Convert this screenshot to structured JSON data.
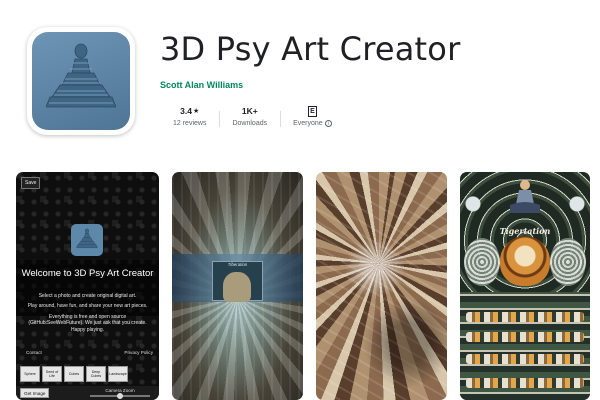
{
  "app": {
    "title": "3D Psy Art Creator",
    "developer": "Scott Alan Williams"
  },
  "stats": {
    "rating_value": "3.4",
    "rating_star": "★",
    "reviews_label": "12 reviews",
    "downloads_value": "1K+",
    "downloads_label": "Downloads",
    "content_rating_badge": "E",
    "content_rating_label": "Everyone",
    "info_glyph": "i"
  },
  "screenshots": {
    "app_ui": {
      "save_button": "Save",
      "welcome_heading": "Welcome to 3D Psy Art Creator",
      "body_lines": [
        "Select a photo and create original digital art.",
        "Play around, have fun, and share your new art pieces.",
        "Everything is free and open source (GitHub:SeeWebFuture). We just ask that you create. Happy playing."
      ],
      "contact_label": "Contact",
      "privacy_label": "Privacy Policy",
      "presets": [
        "Sphere",
        "Seed of Life",
        "Cubes",
        "Deep Cubes",
        "Landscape"
      ],
      "get_image_button": "Get Image",
      "camera_zoom_label": "Camera Zoom",
      "camera_zoom_value": 0.5
    },
    "art2_label": "Tiberation",
    "art4_title": "Tigertation"
  },
  "colors": {
    "developer_green": "#01875f",
    "icon_blue": "#5e88aa",
    "text_dark": "#202124",
    "text_muted": "#5f6368"
  },
  "icons": {
    "app_icon": "meditating-figure-icon",
    "star": "star-icon",
    "info": "info-icon",
    "content_rating": "esrb-everyone-icon"
  }
}
